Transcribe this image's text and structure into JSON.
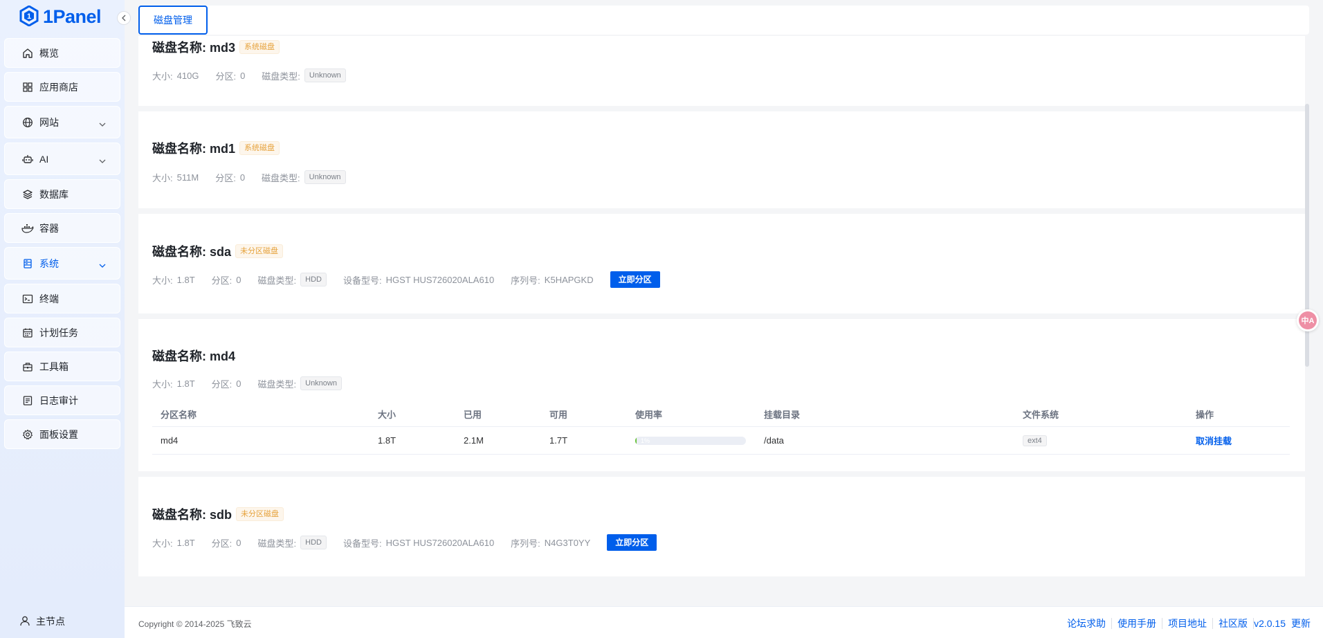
{
  "brand": {
    "logo_text": "1Panel"
  },
  "sidebar": {
    "items": [
      {
        "label": "概览",
        "icon": "home-icon"
      },
      {
        "label": "应用商店",
        "icon": "grid-icon"
      },
      {
        "label": "网站",
        "icon": "globe-icon",
        "expandable": true
      },
      {
        "label": "AI",
        "icon": "robot-icon",
        "expandable": true
      },
      {
        "label": "数据库",
        "icon": "layers-icon"
      },
      {
        "label": "容器",
        "icon": "docker-icon"
      },
      {
        "label": "系统",
        "icon": "server-icon",
        "expandable": true,
        "active": true
      },
      {
        "label": "终端",
        "icon": "terminal-icon"
      },
      {
        "label": "计划任务",
        "icon": "calendar-icon"
      },
      {
        "label": "工具箱",
        "icon": "toolbox-icon"
      },
      {
        "label": "日志审计",
        "icon": "log-icon"
      },
      {
        "label": "面板设置",
        "icon": "gear-icon"
      }
    ],
    "node_label": "主节点"
  },
  "tabs": {
    "active": "磁盘管理"
  },
  "disks": [
    {
      "title": "磁盘名称: md3",
      "badge": "系统磁盘",
      "size_label": "大小:",
      "size": "410G",
      "part_label": "分区:",
      "partitions": "0",
      "type_label": "磁盘类型:",
      "type": "Unknown"
    },
    {
      "title": "磁盘名称: md1",
      "badge": "系统磁盘",
      "size_label": "大小:",
      "size": "511M",
      "part_label": "分区:",
      "partitions": "0",
      "type_label": "磁盘类型:",
      "type": "Unknown"
    },
    {
      "title": "磁盘名称: sda",
      "badge": "未分区磁盘",
      "size_label": "大小:",
      "size": "1.8T",
      "part_label": "分区:",
      "partitions": "0",
      "type_label": "磁盘类型:",
      "type": "HDD",
      "model_label": "设备型号:",
      "model": "HGST HUS726020ALA610",
      "serial_label": "序列号:",
      "serial": "K5HAPGKD",
      "action": "立即分区"
    },
    {
      "title": "磁盘名称: md4",
      "size_label": "大小:",
      "size": "1.8T",
      "part_label": "分区:",
      "partitions": "0",
      "type_label": "磁盘类型:",
      "type": "Unknown",
      "table": {
        "headers": [
          "分区名称",
          "大小",
          "已用",
          "可用",
          "使用率",
          "挂载目录",
          "文件系统",
          "操作"
        ],
        "rows": [
          {
            "name": "md4",
            "size": "1.8T",
            "used": "2.1M",
            "avail": "1.7T",
            "usage_pct": 1,
            "usage_label": "1%",
            "mount": "/data",
            "fs": "ext4",
            "action": "取消挂载"
          }
        ]
      }
    },
    {
      "title": "磁盘名称: sdb",
      "badge": "未分区磁盘",
      "size_label": "大小:",
      "size": "1.8T",
      "part_label": "分区:",
      "partitions": "0",
      "type_label": "磁盘类型:",
      "type": "HDD",
      "model_label": "设备型号:",
      "model": "HGST HUS726020ALA610",
      "serial_label": "序列号:",
      "serial": "N4G3T0YY",
      "action": "立即分区"
    }
  ],
  "translate": {
    "label": "中A"
  },
  "footer": {
    "copyright": "Copyright © 2014-2025 飞致云",
    "links": [
      "论坛求助",
      "使用手册",
      "项目地址",
      "社区版"
    ],
    "version": "v2.0.15",
    "update": "更新"
  },
  "colors": {
    "primary": "#005eeb",
    "warning": "#e6a23c",
    "success": "#67c23a"
  }
}
